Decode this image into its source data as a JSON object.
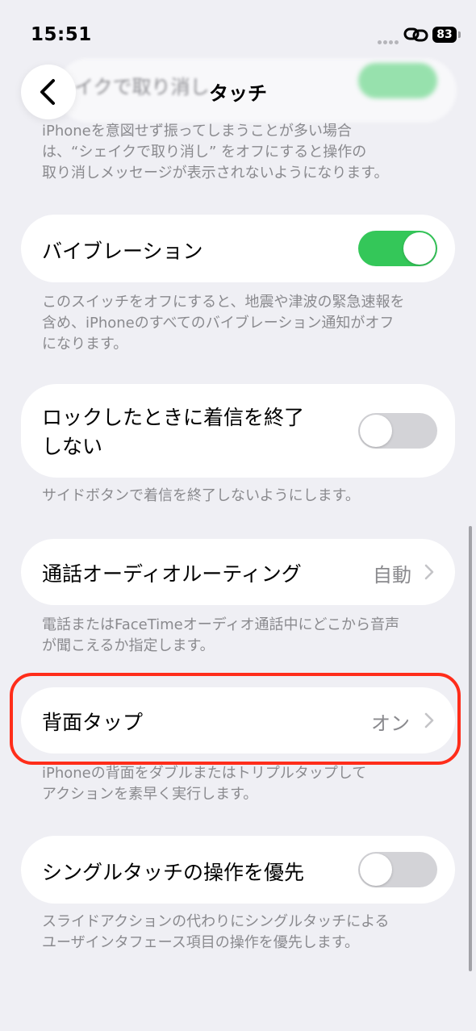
{
  "status_bar": {
    "time": "15:51",
    "battery": "83"
  },
  "header": {
    "title": "タッチ",
    "back_icon": "chevron-left-icon",
    "behind_text": "イクで取り消し"
  },
  "shake_footer": {
    "lines": [
      "iPhoneを意図せず振ってしまうことが多い場合",
      "は、“シェイクで取り消し” をオフにすると操作の",
      "取り消しメッセージが表示されないようになります。"
    ]
  },
  "vibration": {
    "label": "バイブレーション",
    "toggle": "on",
    "footer": [
      "このスイッチをオフにすると、地震や津波の緊急速報を",
      "含め、iPhoneのすべてのバイブレーション通知がオフ",
      "になります。"
    ]
  },
  "prevent_lock_end_call": {
    "label_lines": [
      "ロックしたときに着信を終了",
      "しない"
    ],
    "toggle": "off",
    "footer": [
      "サイドボタンで着信を終了しないようにします。"
    ]
  },
  "call_audio_routing": {
    "label": "通話オーディオルーティング",
    "value": "自動",
    "footer": [
      "電話またはFaceTimeオーディオ通話中にどこから音声",
      "が聞こえるか指定します。"
    ]
  },
  "back_tap": {
    "label": "背面タップ",
    "value": "オン",
    "footer": [
      "iPhoneの背面をダブルまたはトリプルタップして",
      "アクションを素早く実行します。"
    ]
  },
  "single_touch": {
    "label": "シングルタッチの操作を優先",
    "toggle": "off",
    "footer": [
      "スライドアクションの代わりにシングルタッチによる",
      "ユーザインタフェース項目の操作を優先します。"
    ]
  },
  "colors": {
    "accent_green": "#34c759",
    "highlight_red": "#ff2d1a",
    "background": "#efeff4"
  }
}
